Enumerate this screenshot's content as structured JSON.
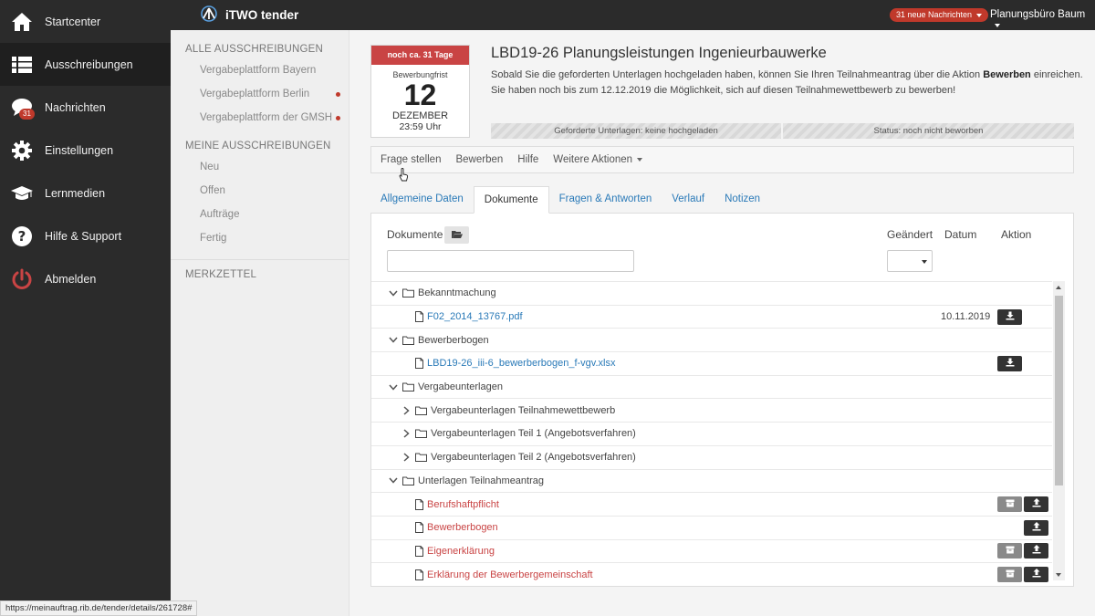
{
  "nav": {
    "items": [
      {
        "label": "Startcenter",
        "icon": "home-icon"
      },
      {
        "label": "Ausschreibungen",
        "icon": "list-icon"
      },
      {
        "label": "Nachrichten",
        "icon": "chat-icon",
        "badge": "31"
      },
      {
        "label": "Einstellungen",
        "icon": "gear-icon"
      },
      {
        "label": "Lernmedien",
        "icon": "graduation-cap-icon"
      },
      {
        "label": "Hilfe & Support",
        "icon": "question-icon"
      },
      {
        "label": "Abmelden",
        "icon": "power-icon"
      }
    ]
  },
  "topbar": {
    "app_name": "iTWO tender",
    "messages_badge": "31 neue Nachrichten",
    "company": "Planungsbüro Baum"
  },
  "subnav": {
    "section1_title": "ALLE AUSSCHREIBUNGEN",
    "section1_items": [
      "Vergabeplattform Bayern",
      "Vergabeplattform Berlin",
      "Vergabeplattform der GMSH"
    ],
    "section2_title": "MEINE AUSSCHREIBUNGEN",
    "section2_items": [
      "Neu",
      "Offen",
      "Aufträge",
      "Fertig"
    ],
    "section3_title": "MERKZETTEL"
  },
  "deadline": {
    "header": "noch ca. 31 Tage",
    "label": "Bewerbungfrist",
    "day": "12",
    "month": "DEZEMBER",
    "time": "23:59 Uhr"
  },
  "tender": {
    "title": "LBD19-26 Planungsleistungen Ingenieurbauwerke",
    "desc_line1_a": "Sobald Sie die geforderten Unterlagen hochgeladen haben, können Sie Ihren Teilnahmeantrag über die Aktion ",
    "desc_line1_bold": "Bewerben",
    "desc_line1_b": " einreichen.",
    "desc_line2": "Sie haben noch bis zum 12.12.2019 die Möglichkeit, sich auf diesen Teilnahmewettbewerb zu bewerben!",
    "status_documents": "Geforderte Unterlagen: keine hochgeladen",
    "status_application": "Status: noch nicht beworben"
  },
  "actions": [
    "Frage stellen",
    "Bewerben",
    "Hilfe",
    "Weitere Aktionen"
  ],
  "tabs": [
    "Allgemeine Daten",
    "Dokumente",
    "Fragen & Antworten",
    "Verlauf",
    "Notizen"
  ],
  "documents": {
    "header_documents": "Dokumente",
    "header_changed": "Geändert",
    "header_date": "Datum",
    "header_action": "Aktion",
    "rows": [
      {
        "type": "folder",
        "level": 0,
        "expanded": true,
        "name": "Bekanntmachung"
      },
      {
        "type": "file",
        "level": 1,
        "style": "link",
        "name": "F02_2014_13767.pdf",
        "date": "10.11.2019",
        "buttons": [
          "download"
        ]
      },
      {
        "type": "folder",
        "level": 0,
        "expanded": true,
        "name": "Bewerberbogen"
      },
      {
        "type": "file",
        "level": 1,
        "style": "link",
        "name": "LBD19-26_iii-6_bewerberbogen_f-vgv.xlsx",
        "date": "",
        "buttons": [
          "download"
        ]
      },
      {
        "type": "folder",
        "level": 0,
        "expanded": true,
        "name": "Vergabeunterlagen"
      },
      {
        "type": "folder",
        "level": 1,
        "expanded": false,
        "name": "Vergabeunterlagen Teilnahmewettbewerb"
      },
      {
        "type": "folder",
        "level": 1,
        "expanded": false,
        "name": "Vergabeunterlagen Teil 1 (Angebotsverfahren)"
      },
      {
        "type": "folder",
        "level": 1,
        "expanded": false,
        "name": "Vergabeunterlagen Teil 2 (Angebotsverfahren)"
      },
      {
        "type": "folder",
        "level": 0,
        "expanded": true,
        "name": "Unterlagen Teilnahmeantrag"
      },
      {
        "type": "file",
        "level": 1,
        "style": "req",
        "name": "Berufshaftpflicht",
        "date": "",
        "buttons": [
          "archive",
          "upload"
        ]
      },
      {
        "type": "file",
        "level": 1,
        "style": "req",
        "name": "Bewerberbogen",
        "date": "",
        "buttons": [
          "upload"
        ]
      },
      {
        "type": "file",
        "level": 1,
        "style": "req",
        "name": "Eigenerklärung",
        "date": "",
        "buttons": [
          "archive",
          "upload"
        ]
      },
      {
        "type": "file",
        "level": 1,
        "style": "req",
        "name": "Erklärung der Bewerbergemeinschaft",
        "date": "",
        "buttons": [
          "archive",
          "upload"
        ]
      }
    ]
  },
  "status_url": "https://meinauftrag.rib.de/tender/details/261728#",
  "colors": {
    "accent": "#2a7ab8",
    "danger": "#c94444",
    "sidebar": "#2b2b2b"
  }
}
